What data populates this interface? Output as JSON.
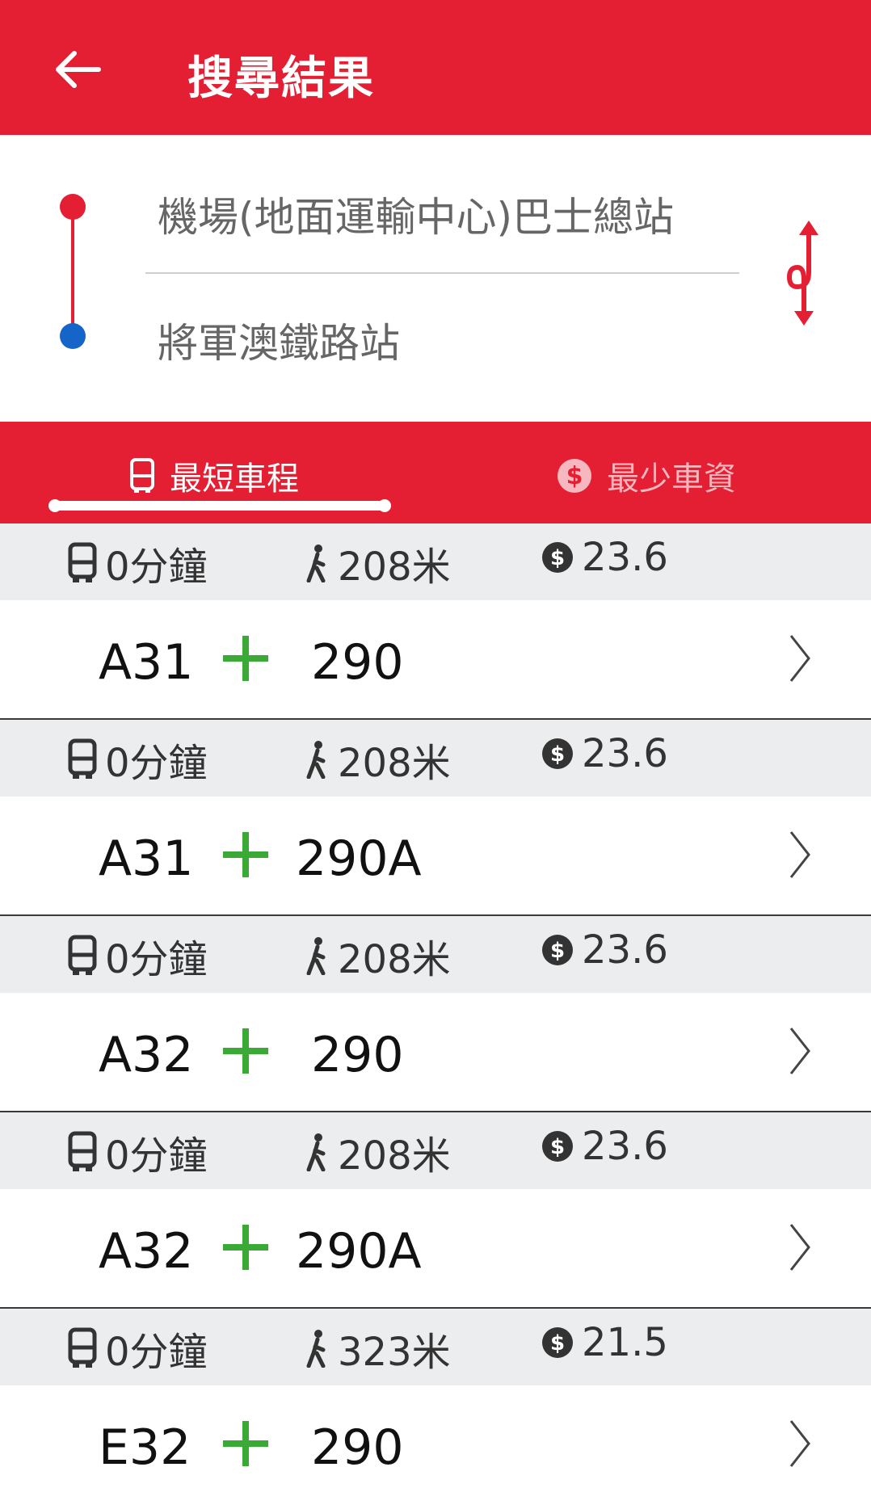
{
  "header": {
    "title": "搜尋結果",
    "back_icon": "arrow-left-icon",
    "color": "#e41f33"
  },
  "route": {
    "origin": "機場(地面運輸中心)巴士總站",
    "destination": "將軍澳鐵路站",
    "origin_color": "#e41f33",
    "destination_color": "#1565c8",
    "swap_icon": "swap-vertical-icon"
  },
  "tabs": [
    {
      "label": "最短車程",
      "icon": "bus-icon",
      "active": true
    },
    {
      "label": "最少車資",
      "icon": "dollar-circle-icon",
      "active": false
    }
  ],
  "results": [
    {
      "time": "0分鐘",
      "walk": "208米",
      "fare": "23.6",
      "route_a": "A31",
      "route_b": "290"
    },
    {
      "time": "0分鐘",
      "walk": "208米",
      "fare": "23.6",
      "route_a": "A31",
      "route_b": "290A"
    },
    {
      "time": "0分鐘",
      "walk": "208米",
      "fare": "23.6",
      "route_a": "A32",
      "route_b": "290"
    },
    {
      "time": "0分鐘",
      "walk": "208米",
      "fare": "23.6",
      "route_a": "A32",
      "route_b": "290A"
    },
    {
      "time": "0分鐘",
      "walk": "323米",
      "fare": "21.5",
      "route_a": "E32",
      "route_b": "290"
    }
  ]
}
